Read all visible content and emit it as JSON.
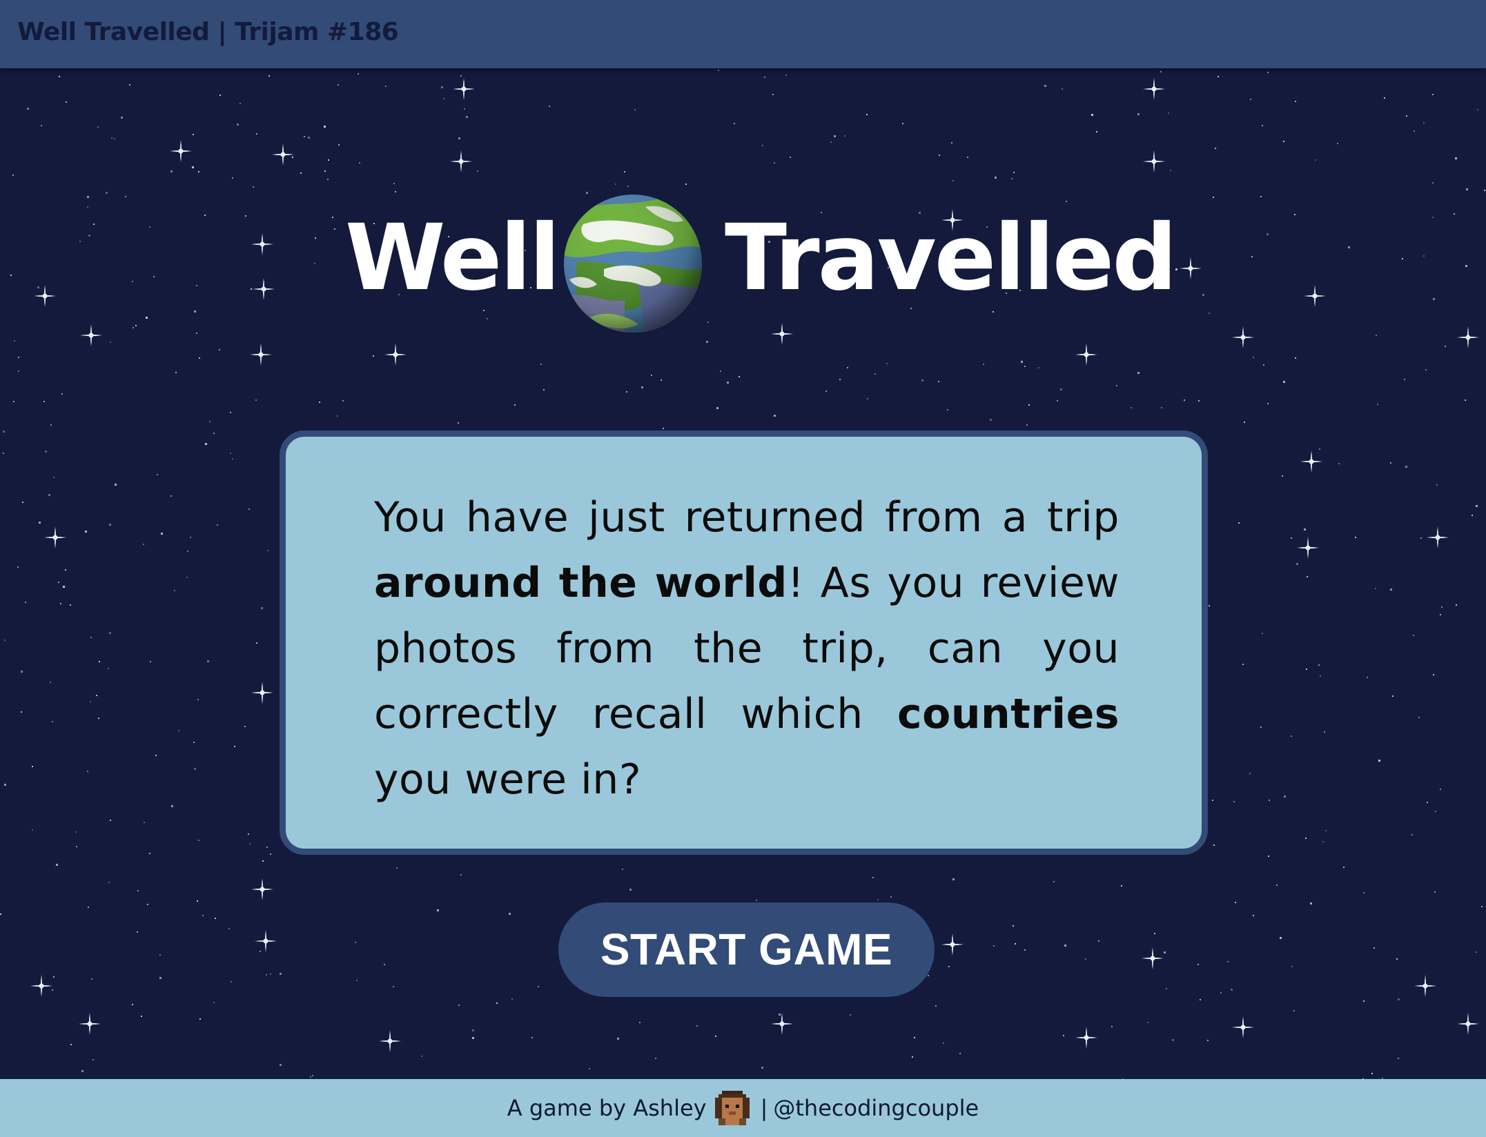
{
  "header": {
    "title": "Well Travelled | Trijam #186"
  },
  "title": {
    "word_left": "Well",
    "globe_icon": "earth-globe-icon",
    "word_right": "Travelled"
  },
  "intro": {
    "part1": "You have just returned from a trip ",
    "bold1": "around the world",
    "part2": "! As you review photos from the trip, can you correctly recall which ",
    "bold2": "countries",
    "part3": " you were in?"
  },
  "start_button": {
    "label": "START GAME"
  },
  "footer": {
    "prefix": "A game by Ashley",
    "avatar_icon": "ashley-avatar-icon",
    "separator": "|",
    "handle": "@thecodingcouple"
  },
  "colors": {
    "header_bg": "#324b77",
    "space_bg": "#131a3b",
    "card_bg": "#9ac8da",
    "card_border": "#324b77",
    "button_bg": "#324b77",
    "footer_bg": "#9ac8da",
    "title_text": "#ffffff"
  }
}
